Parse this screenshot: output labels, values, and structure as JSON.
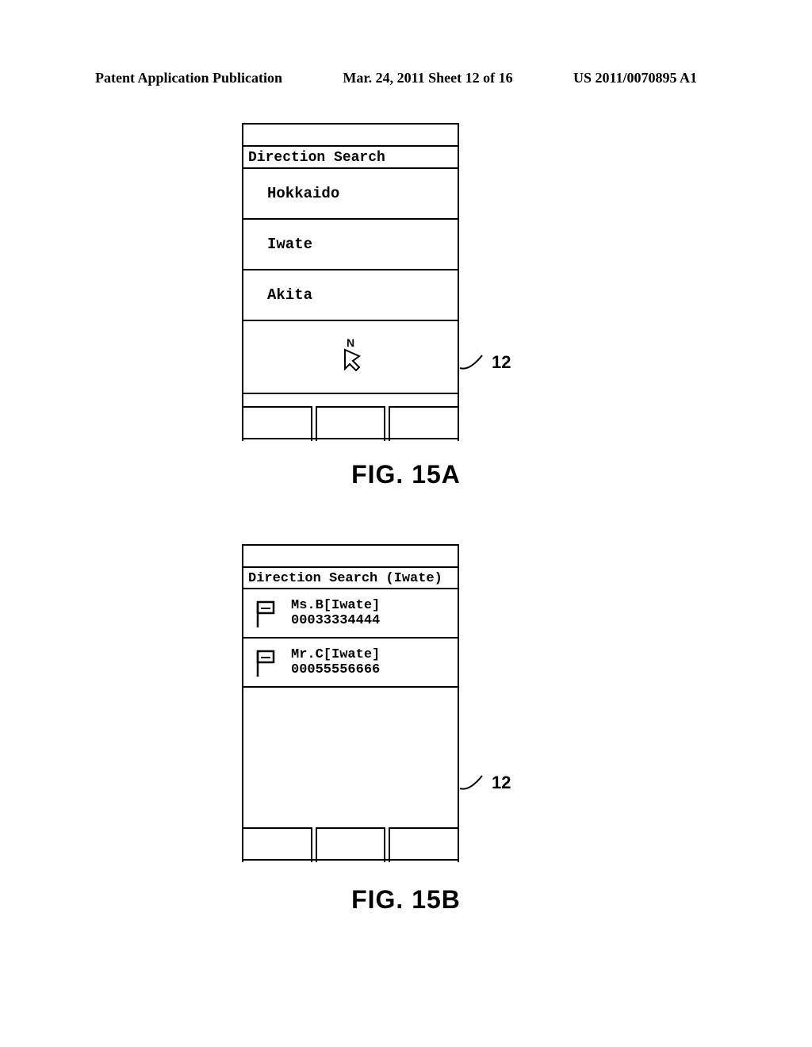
{
  "header": {
    "left": "Patent Application Publication",
    "center": "Mar. 24, 2011  Sheet 12 of 16",
    "right": "US 2011/0070895 A1"
  },
  "figA": {
    "title": "Direction Search",
    "items": [
      "Hokkaido",
      "Iwate",
      "Akita"
    ],
    "compass_label": "N",
    "callout": "12",
    "label": "FIG. 15A"
  },
  "figB": {
    "title": "Direction Search (Iwate)",
    "items": [
      {
        "name": "Ms.B[Iwate]",
        "number": "00033334444"
      },
      {
        "name": "Mr.C[Iwate]",
        "number": "00055556666"
      }
    ],
    "callout": "12",
    "label": "FIG. 15B"
  }
}
